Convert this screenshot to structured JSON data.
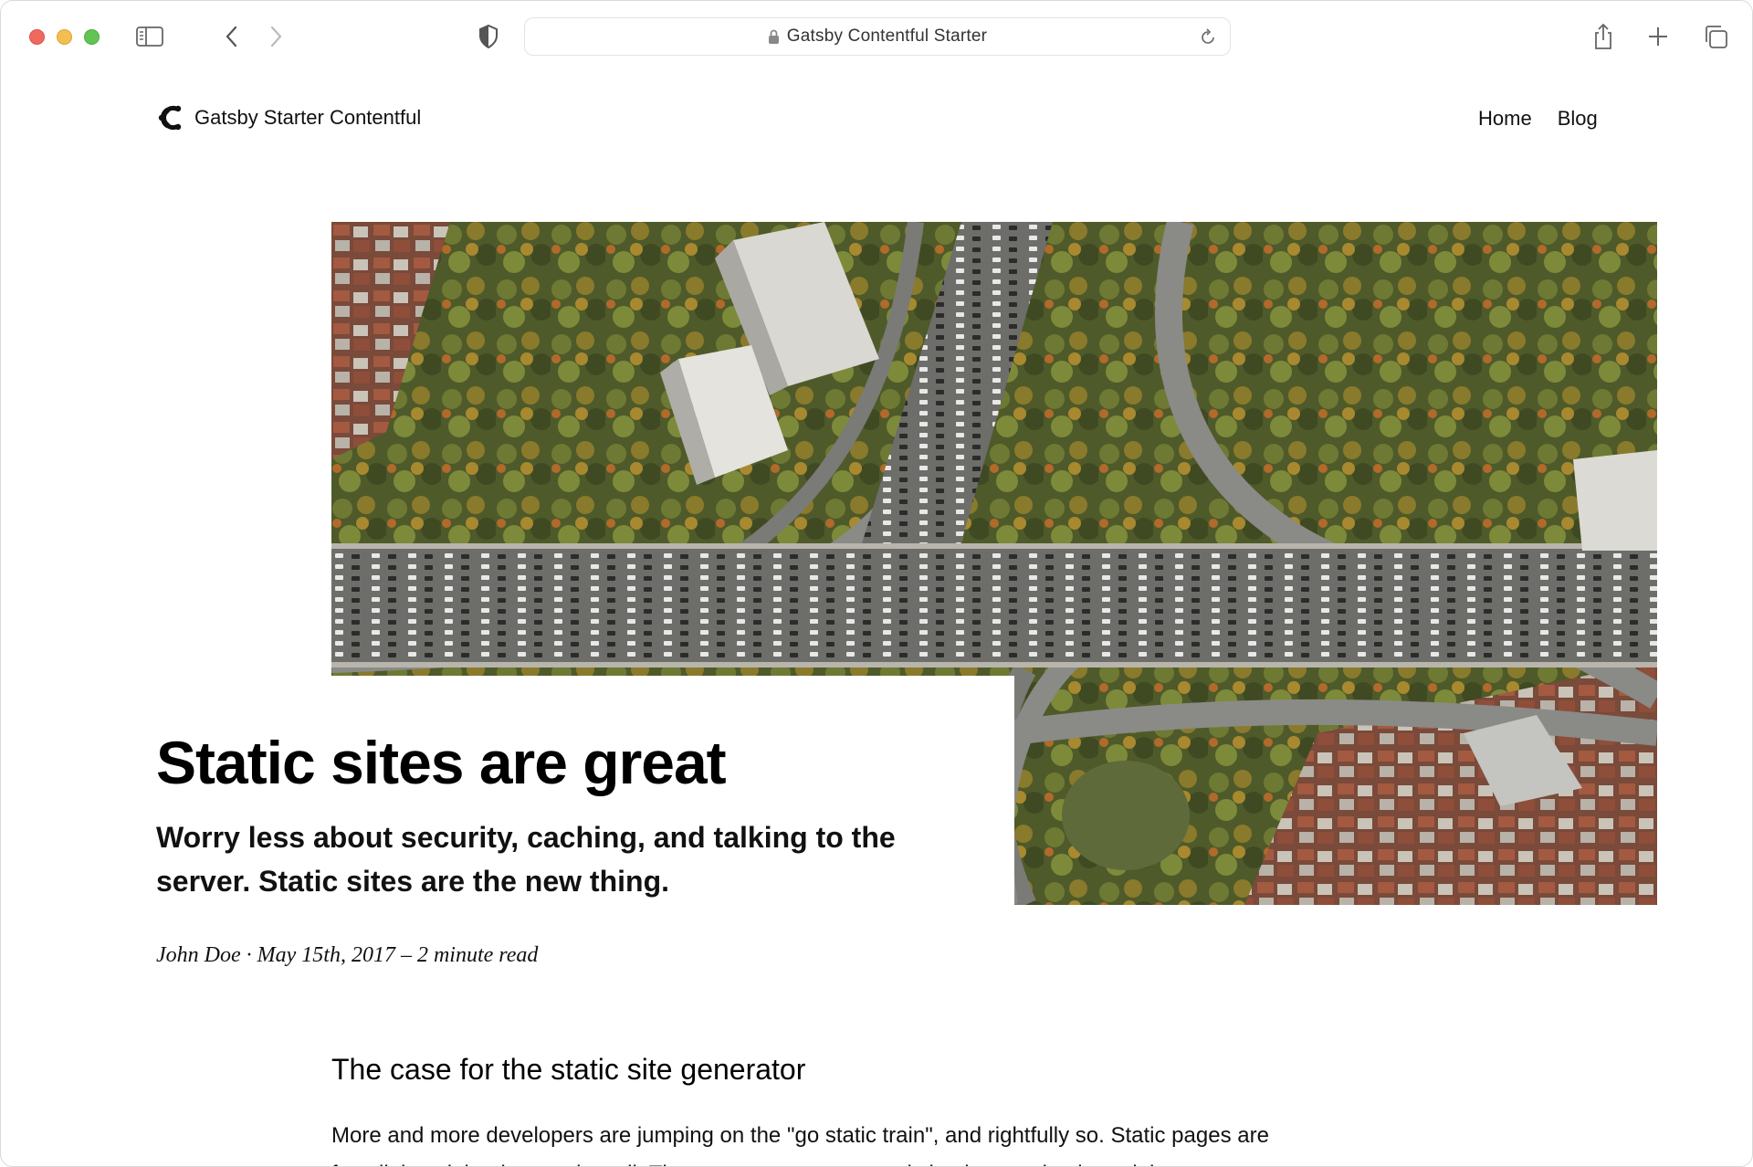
{
  "browser": {
    "url_text": "Gatsby Contentful Starter",
    "icons": [
      "sidebar-icon",
      "back-icon",
      "forward-icon",
      "shield-icon",
      "lock-icon",
      "reload-icon",
      "share-icon",
      "plus-icon",
      "tabs-icon"
    ]
  },
  "site": {
    "name": "Gatsby Starter Contentful",
    "nav": [
      {
        "label": "Home"
      },
      {
        "label": "Blog"
      }
    ]
  },
  "hero": {
    "title": "Static sites are great",
    "subtitle": "Worry less about security, caching, and talking to the server. Static sites are the new thing.",
    "byline": "John Doe · May 15th, 2017 – 2 minute read"
  },
  "article": {
    "heading": "The case for the static site generator",
    "paragraph": "More and more developers are jumping on the \"go static train\", and rightfully so. Static pages are fast, lightweight, they scale well. They are more secure, and simple to maintain and they"
  }
}
